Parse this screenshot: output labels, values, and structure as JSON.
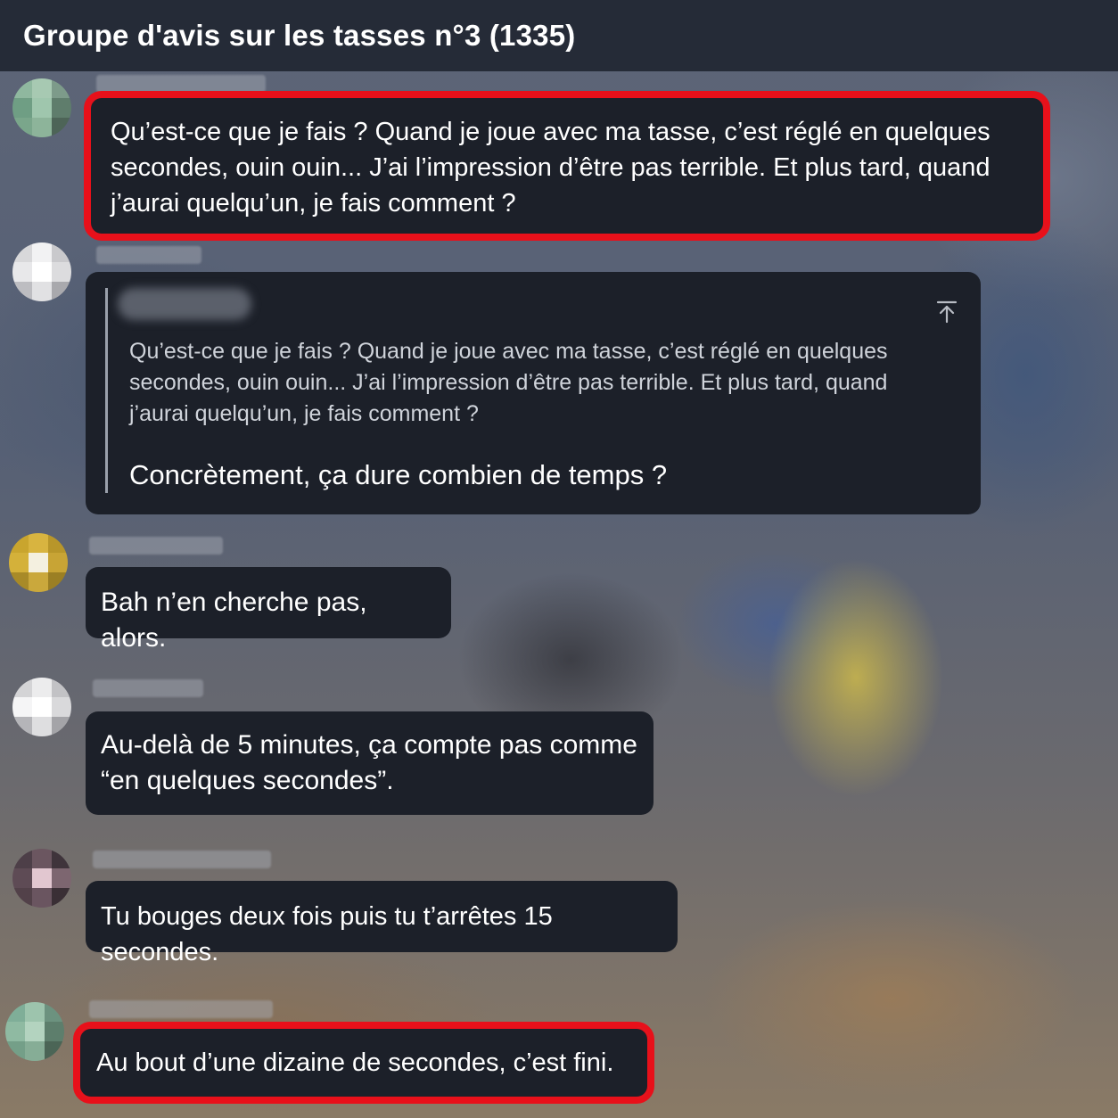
{
  "header": {
    "title": "Groupe d'avis sur les tasses n°3 (1335)"
  },
  "messages": [
    {
      "text": "Qu’est-ce que je fais ? Quand je joue avec ma tasse, c’est réglé en quelques secondes, ouin ouin... J’ai l’impression d’être pas terrible. Et plus tard, quand j’aurai quelqu’un, je fais comment ?",
      "highlighted": true
    },
    {
      "quote": "Qu’est-ce que je fais ? Quand je joue avec ma tasse, c’est réglé en quelques secondes, ouin ouin... J’ai l’impression d’être pas terrible. Et plus tard, quand j’aurai quelqu’un, je fais comment ?",
      "text": "Concrètement, ça dure combien de temps ?",
      "highlighted": false
    },
    {
      "text": "Bah n’en cherche pas, alors.",
      "highlighted": false
    },
    {
      "text": "Au-delà de 5 minutes, ça compte pas comme “en quelques secondes”.",
      "highlighted": false
    },
    {
      "text": "Tu bouges deux fois puis tu t’arrêtes 15 secondes.",
      "highlighted": false
    },
    {
      "text": "Au bout d’une dizaine de secondes, c’est fini.",
      "highlighted": true
    }
  ],
  "colors": {
    "header_bg": "#252b37",
    "bubble_bg": "#1c2029",
    "highlight": "#e8101a"
  },
  "icons": {
    "jump": "arrow-up-to-top-icon"
  }
}
